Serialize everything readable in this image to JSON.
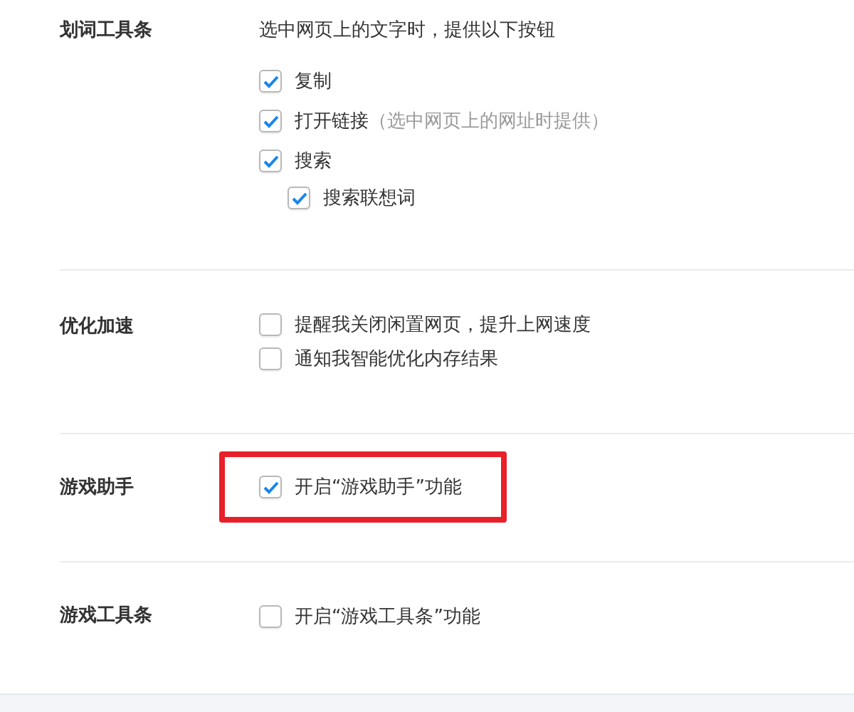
{
  "sections": [
    {
      "title": "划词工具条",
      "intro": "选中网页上的文字时，提供以下按钮",
      "highlighted": false,
      "options": [
        {
          "label": "复制",
          "checked": true
        },
        {
          "label": "打开链接",
          "note": "（选中网页上的网址时提供）",
          "checked": true
        },
        {
          "label": "搜索",
          "checked": true,
          "children": [
            {
              "label": "搜索联想词",
              "checked": true
            }
          ]
        }
      ]
    },
    {
      "title": "优化加速",
      "highlighted": false,
      "options": [
        {
          "label": "提醒我关闭闲置网页，提升上网速度",
          "checked": false
        },
        {
          "label": "通知我智能优化内存结果",
          "checked": false
        }
      ]
    },
    {
      "title": "游戏助手",
      "highlighted": true,
      "options": [
        {
          "label": "开启“游戏助手”功能",
          "checked": true
        }
      ]
    },
    {
      "title": "游戏工具条",
      "highlighted": false,
      "options": [
        {
          "label": "开启“游戏工具条”功能",
          "checked": false
        }
      ]
    }
  ]
}
